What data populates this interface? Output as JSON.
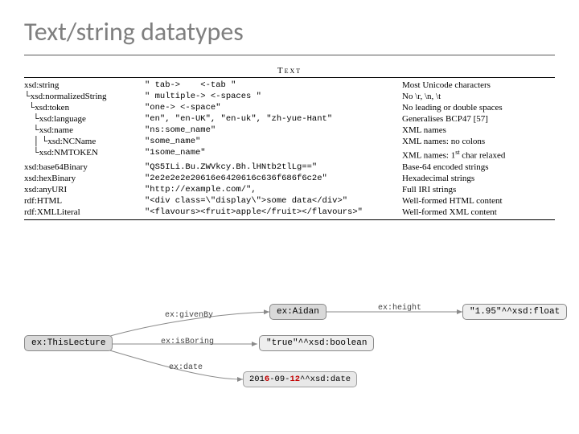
{
  "title": "Text/string datatypes",
  "table": {
    "header": "Text",
    "rows": [
      {
        "indent": 0,
        "type": "xsd:string",
        "ex": "\" tab->    <-tab \"",
        "desc": "Most Unicode characters"
      },
      {
        "indent": 1,
        "type": "xsd:normalizedString",
        "ex": "\" multiple-> <-spaces \"",
        "desc": "No \\r, \\n, \\t"
      },
      {
        "indent": 2,
        "type": "xsd:token",
        "ex": "\"one-> <-space\"",
        "desc": "No leading or double spaces"
      },
      {
        "indent": 3,
        "type": "xsd:language",
        "ex": "\"en\", \"en-UK\", \"en-uk\", \"zh-yue-Hant\"",
        "desc": "Generalises BCP47 [57]"
      },
      {
        "indent": 3,
        "type": "xsd:name",
        "ex": "\"ns:some_name\"",
        "desc": "XML names"
      },
      {
        "indent": 4,
        "type": "xsd:NCName",
        "ex": "\"some_name\"",
        "desc": "XML names: no colons"
      },
      {
        "indent": 3,
        "type": "xsd:NMTOKEN",
        "ex": "\"1some_name\"",
        "desc_html": "XML names: 1<sup>st</sup> char relaxed"
      },
      {
        "indent": 0,
        "type": "xsd:base64Binary",
        "ex": "\"QS5ILi.Bu.ZWVkcy.Bh.lHNtb2tlLg==\"",
        "desc": "Base-64 encoded strings"
      },
      {
        "indent": 0,
        "type": "xsd:hexBinary",
        "ex": "\"2e2e2e2e20616e6420616c636f686f6c2e\"",
        "desc": "Hexadecimal strings"
      },
      {
        "indent": 0,
        "type": "xsd:anyURI",
        "ex": "\"http://example.com/\",",
        "desc": "Full IRI strings"
      },
      {
        "indent": 0,
        "type": "rdf:HTML",
        "ex": "\"<div class=\\\"display\\\">some data</div>\"",
        "desc": "Well-formed HTML content"
      },
      {
        "indent": 0,
        "type": "rdf:XMLLiteral",
        "ex": "\"<flavours><fruit>apple</fruit></flavours>\"",
        "desc": "Well-formed XML content"
      }
    ]
  },
  "graph": {
    "nodes": {
      "this": {
        "label": "ex:ThisLecture"
      },
      "aidan": {
        "label": "ex:Aidan"
      },
      "true": {
        "label": "\"true\"^^xsd:boolean"
      },
      "height": {
        "label": "\"1.95\"^^xsd:float"
      },
      "date": {
        "prefix": "201",
        "m1": "6",
        "mid": "-09-",
        "m2": "12",
        "suffix": "^^xsd:date"
      }
    },
    "edges": {
      "givenBy": "ex:givenBy",
      "isBoring": "ex:isBoring",
      "date": "ex:date",
      "height": "ex:height"
    }
  }
}
